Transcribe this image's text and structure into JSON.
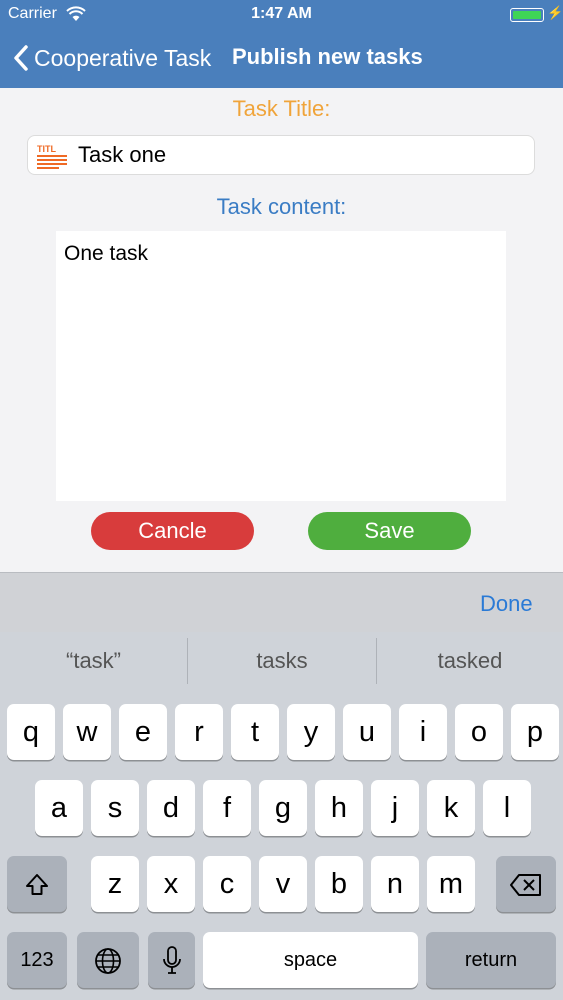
{
  "status": {
    "carrier": "Carrier",
    "time": "1:47 AM"
  },
  "nav": {
    "back_label": "Cooperative Task",
    "title": "Publish new tasks"
  },
  "form": {
    "title_label": "Task Title:",
    "title_value": "Task one",
    "content_label": "Task content:",
    "content_value": "One task",
    "cancel_label": "Cancle",
    "save_label": "Save"
  },
  "icons": {
    "title_icon_text": "TITL"
  },
  "colors": {
    "header": "#4a7fbc",
    "title_label": "#f0a43a",
    "content_label": "#3a7cc4",
    "cancel": "#d83c3c",
    "save": "#4fae3e",
    "done": "#2a7ad6"
  },
  "keyboard": {
    "done_label": "Done",
    "suggestions": [
      "“task”",
      "tasks",
      "tasked"
    ],
    "row1": [
      "q",
      "w",
      "e",
      "r",
      "t",
      "y",
      "u",
      "i",
      "o",
      "p"
    ],
    "row2": [
      "a",
      "s",
      "d",
      "f",
      "g",
      "h",
      "j",
      "k",
      "l"
    ],
    "row3": [
      "z",
      "x",
      "c",
      "v",
      "b",
      "n",
      "m"
    ],
    "numbers_label": "123",
    "space_label": "space",
    "return_label": "return"
  }
}
